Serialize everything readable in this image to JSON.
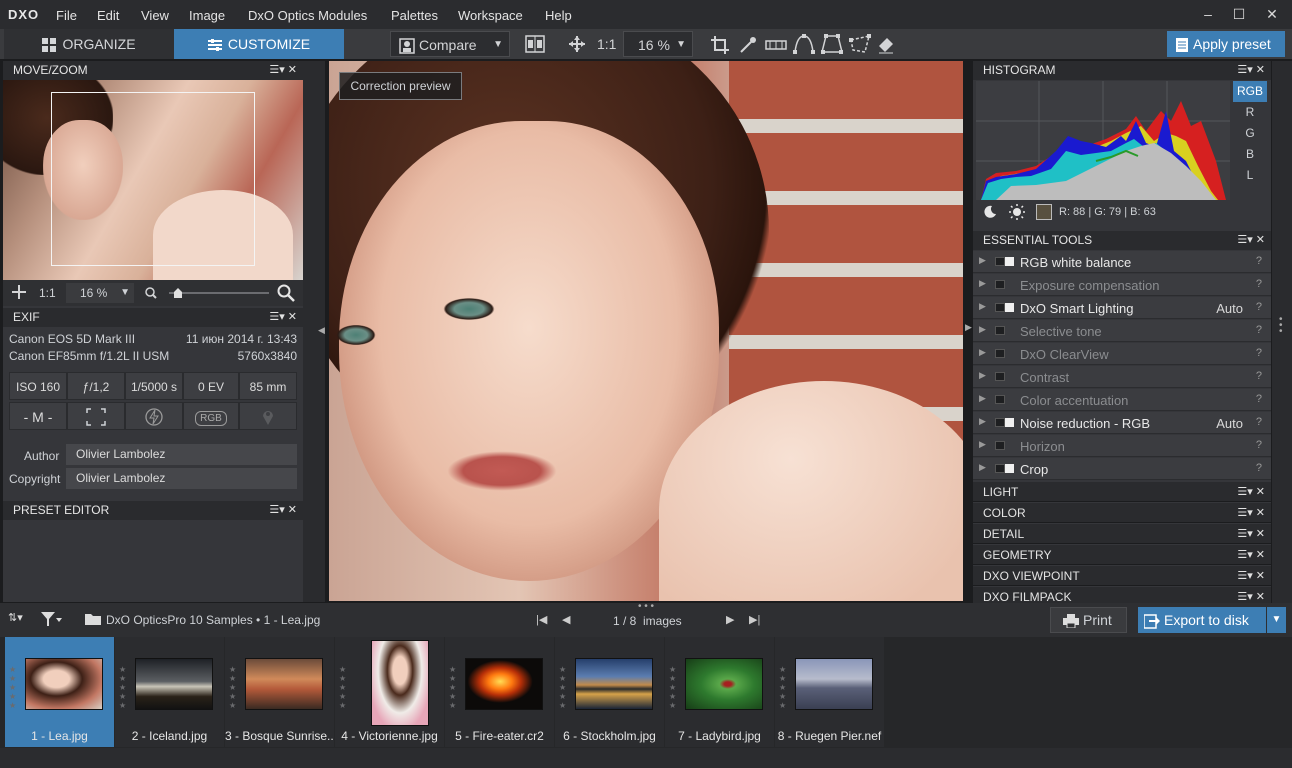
{
  "app": {
    "logo": "DXO"
  },
  "menu": [
    "File",
    "Edit",
    "View",
    "Image",
    "DxO Optics Modules",
    "Palettes",
    "Workspace",
    "Help"
  ],
  "window_controls": {
    "minimize": "–",
    "maximize": "☐",
    "close": "✕"
  },
  "toolbar": {
    "organize": "ORGANIZE",
    "customize": "CUSTOMIZE",
    "compare": "Compare",
    "one_to_one": "1:1",
    "zoom": "16 %",
    "apply_preset": "Apply preset"
  },
  "move_zoom": {
    "title": "MOVE/ZOOM",
    "one_to_one": "1:1",
    "zoom": "16 %",
    "zoom_level": 0.05
  },
  "exif": {
    "title": "EXIF",
    "camera": "Canon EOS 5D Mark III",
    "date": "11 июн 2014 г. 13:43",
    "lens": "Canon EF85mm f/1.2L II USM",
    "resolution": "5760x3840",
    "iso": "ISO 160",
    "aperture": "ƒ/1,2",
    "shutter": "1/5000 s",
    "ev": "0 EV",
    "focal": "85 mm",
    "mode": "- M -",
    "rgb": "RGB",
    "author_label": "Author",
    "author": "Olivier Lambolez",
    "copyright_label": "Copyright",
    "copyright": "Olivier Lambolez"
  },
  "preset_editor": {
    "title": "PRESET EDITOR"
  },
  "center": {
    "tooltip": "Correction preview"
  },
  "histogram": {
    "title": "HISTOGRAM",
    "channels": [
      "RGB",
      "R",
      "G",
      "B",
      "L"
    ],
    "selected_channel": "RGB",
    "readout": "R: 88 | G: 79 | B: 63",
    "swatch_color": "#58503f"
  },
  "essential_tools": {
    "title": "ESSENTIAL TOOLS",
    "items": [
      {
        "label": "RGB white balance",
        "value": "",
        "active": true
      },
      {
        "label": "Exposure compensation",
        "value": "",
        "active": false
      },
      {
        "label": "DxO Smart Lighting",
        "value": "Auto",
        "active": true
      },
      {
        "label": "Selective tone",
        "value": "",
        "active": false
      },
      {
        "label": "DxO ClearView",
        "value": "",
        "active": false
      },
      {
        "label": "Contrast",
        "value": "",
        "active": false
      },
      {
        "label": "Color accentuation",
        "value": "",
        "active": false
      },
      {
        "label": "Noise reduction - RGB",
        "value": "Auto",
        "active": true
      },
      {
        "label": "Horizon",
        "value": "",
        "active": false
      },
      {
        "label": "Crop",
        "value": "",
        "active": true
      }
    ],
    "help": "?"
  },
  "sections": [
    "LIGHT",
    "COLOR",
    "DETAIL",
    "GEOMETRY",
    "DXO VIEWPOINT",
    "DXO FILMPACK"
  ],
  "bottom": {
    "breadcrumb": "DxO OpticsPro 10 Samples  •  1 - Lea.jpg",
    "page": "1 / 8",
    "page_label": "images",
    "print": "Print",
    "export": "Export to disk"
  },
  "filmstrip": [
    {
      "caption": "1 - Lea.jpg",
      "selected": true
    },
    {
      "caption": "2 - Iceland.jpg",
      "selected": false
    },
    {
      "caption": "3 - Bosque Sunrise....",
      "selected": false
    },
    {
      "caption": "4 - Victorienne.jpg",
      "selected": false
    },
    {
      "caption": "5 - Fire-eater.cr2",
      "selected": false
    },
    {
      "caption": "6 - Stockholm.jpg",
      "selected": false
    },
    {
      "caption": "7 - Ladybird.jpg",
      "selected": false
    },
    {
      "caption": "8 - Ruegen Pier.nef",
      "selected": false
    }
  ],
  "colors": {
    "accent": "#3d7eb4",
    "panel": "#35363a",
    "header": "#2a2b2e"
  },
  "icons": [
    "grid-icon",
    "sliders-icon",
    "compare-icon",
    "split-view-icon",
    "move-icon",
    "crop-icon",
    "eyedropper-icon",
    "horizon-icon",
    "volume-deformation-icon",
    "perspective-icon",
    "local-adjust-icon",
    "eraser-icon",
    "preset-icon",
    "magnifier-icon",
    "print-icon",
    "export-icon",
    "filter-icon",
    "sort-icon",
    "folder-icon"
  ]
}
